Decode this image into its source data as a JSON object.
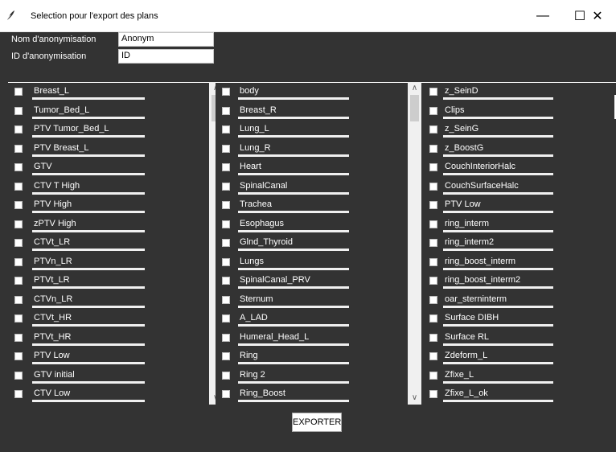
{
  "window": {
    "title": "Selection pour l'export des plans",
    "minimize_glyph": "—",
    "maximize_glyph": "☐",
    "close_glyph": "✕"
  },
  "form": {
    "nom_label": "Nom d'anonymisation",
    "nom_value": "Anonym",
    "id_label": "ID d'anonymisation",
    "id_value": "ID"
  },
  "columns": [
    {
      "items": [
        "Breast_L",
        "Tumor_Bed_L",
        "PTV Tumor_Bed_L",
        "PTV Breast_L",
        "GTV",
        "CTV T High",
        "PTV High",
        "zPTV High",
        "CTVt_LR",
        "PTVn_LR",
        "PTVt_LR",
        "CTVn_LR",
        "CTVt_HR",
        "PTVt_HR",
        "PTV Low",
        "GTV initial",
        "CTV Low"
      ]
    },
    {
      "items": [
        "body",
        "Breast_R",
        "Lung_L",
        "Lung_R",
        "Heart",
        "SpinalCanal",
        "Trachea",
        "Esophagus",
        "Glnd_Thyroid",
        "Lungs",
        "SpinalCanal_PRV",
        "Sternum",
        "A_LAD",
        "Humeral_Head_L",
        "Ring",
        "Ring 2",
        "Ring_Boost"
      ]
    },
    {
      "items": [
        "z_SeinD",
        "Clips",
        "z_SeinG",
        "z_BoostG",
        "CouchInteriorHalc",
        "CouchSurfaceHalc",
        "PTV Low",
        "ring_interm",
        "ring_interm2",
        "ring_boost_interm",
        "ring_boost_interm2",
        "oar_sterninterm",
        "Surface DIBH",
        "Surface RL",
        "Zdeform_L",
        "Zfixe_L",
        "Zfixe_L_ok"
      ]
    }
  ],
  "scrollbar": {
    "up_glyph": "∧",
    "down_glyph": "∨"
  },
  "export_button": "EXPORTER",
  "colors": {
    "background": "#333333",
    "titlebar": "#ffffff",
    "text": "#ffffff"
  }
}
